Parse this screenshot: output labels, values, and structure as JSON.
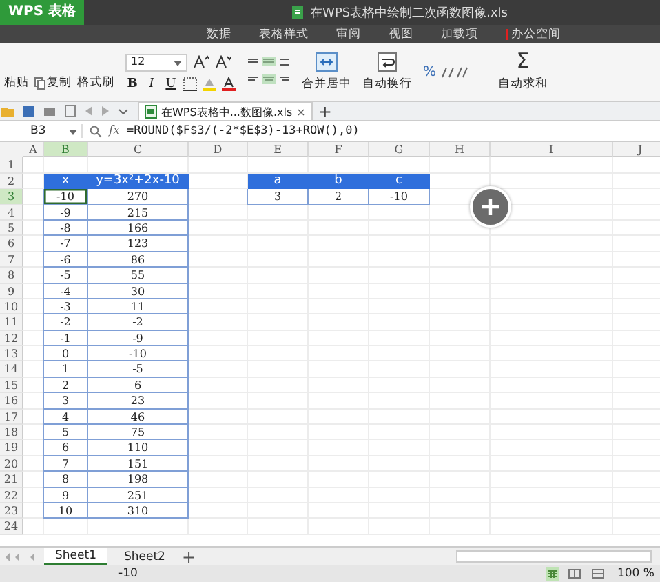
{
  "window": {
    "app_name": "WPS 表格",
    "title": "在WPS表格中绘制二次函数图像.xls"
  },
  "menu_tabs": [
    "数据",
    "表格样式",
    "审阅",
    "视图",
    "加载项",
    "办公空间"
  ],
  "ribbon": {
    "font_size": "12",
    "buttons": [
      {
        "kind": "paste",
        "label": "粘贴"
      },
      {
        "kind": "copy",
        "label": "复制"
      },
      {
        "kind": "brush",
        "label": "格式刷"
      },
      {
        "kind": "merge",
        "label": "合并居中"
      },
      {
        "kind": "wrap",
        "label": "自动换行"
      },
      {
        "kind": "sum",
        "label": "自动求和"
      }
    ],
    "format_buttons": [
      "B",
      "I",
      "U"
    ],
    "sum_symbol": "Σ",
    "percent": "%"
  },
  "doc_tab": {
    "label": "在WPS表格中...数图像.xls",
    "close": "×",
    "add": "+"
  },
  "formula_bar": {
    "name_box": "B3",
    "fx": "fx",
    "formula": "=ROUND($F$3/(-2*$E$3)-13+ROW(),0)"
  },
  "columns": [
    {
      "label": "A",
      "selected": false
    },
    {
      "label": "B",
      "selected": true
    },
    {
      "label": "C",
      "selected": false
    },
    {
      "label": "D",
      "selected": false
    },
    {
      "label": "E",
      "selected": false
    },
    {
      "label": "F",
      "selected": false
    },
    {
      "label": "G",
      "selected": false
    },
    {
      "label": "H",
      "selected": false
    },
    {
      "label": "I",
      "selected": false
    },
    {
      "label": "J",
      "selected": false
    }
  ],
  "rows": [
    {
      "label": "1",
      "selected": false
    },
    {
      "label": "2",
      "selected": false
    },
    {
      "label": "3",
      "selected": true
    },
    {
      "label": "4",
      "selected": false
    },
    {
      "label": "5",
      "selected": false
    },
    {
      "label": "6",
      "selected": false
    },
    {
      "label": "7",
      "selected": false
    },
    {
      "label": "8",
      "selected": false
    },
    {
      "label": "9",
      "selected": false
    },
    {
      "label": "10",
      "selected": false
    },
    {
      "label": "11",
      "selected": false
    },
    {
      "label": "12",
      "selected": false
    },
    {
      "label": "13",
      "selected": false
    },
    {
      "label": "14",
      "selected": false
    },
    {
      "label": "15",
      "selected": false
    },
    {
      "label": "16",
      "selected": false
    },
    {
      "label": "17",
      "selected": false
    },
    {
      "label": "18",
      "selected": false
    },
    {
      "label": "19",
      "selected": false
    },
    {
      "label": "20",
      "selected": false
    },
    {
      "label": "21",
      "selected": false
    },
    {
      "label": "22",
      "selected": false
    },
    {
      "label": "23",
      "selected": false
    },
    {
      "label": "24",
      "selected": false
    }
  ],
  "values_table": {
    "header": [
      "x",
      "y=3x²+2x-10"
    ],
    "rows": [
      [
        "-10",
        "270"
      ],
      [
        "-9",
        "215"
      ],
      [
        "-8",
        "166"
      ],
      [
        "-7",
        "123"
      ],
      [
        "-6",
        "86"
      ],
      [
        "-5",
        "55"
      ],
      [
        "-4",
        "30"
      ],
      [
        "-3",
        "11"
      ],
      [
        "-2",
        "-2"
      ],
      [
        "-1",
        "-9"
      ],
      [
        "0",
        "-10"
      ],
      [
        "1",
        "-5"
      ],
      [
        "2",
        "6"
      ],
      [
        "3",
        "23"
      ],
      [
        "4",
        "46"
      ],
      [
        "5",
        "75"
      ],
      [
        "6",
        "110"
      ],
      [
        "7",
        "151"
      ],
      [
        "8",
        "198"
      ],
      [
        "9",
        "251"
      ],
      [
        "10",
        "310"
      ]
    ]
  },
  "coefficients_table": {
    "header": [
      "a",
      "b",
      "c"
    ],
    "rows": [
      [
        "3",
        "2",
        "-10"
      ]
    ]
  },
  "sheet_tabs": [
    {
      "label": "Sheet1",
      "selected": true
    },
    {
      "label": "Sheet2",
      "selected": false
    }
  ],
  "add_sheet": "+",
  "status_bar": {
    "value": "-10",
    "zoom": "100 %"
  }
}
